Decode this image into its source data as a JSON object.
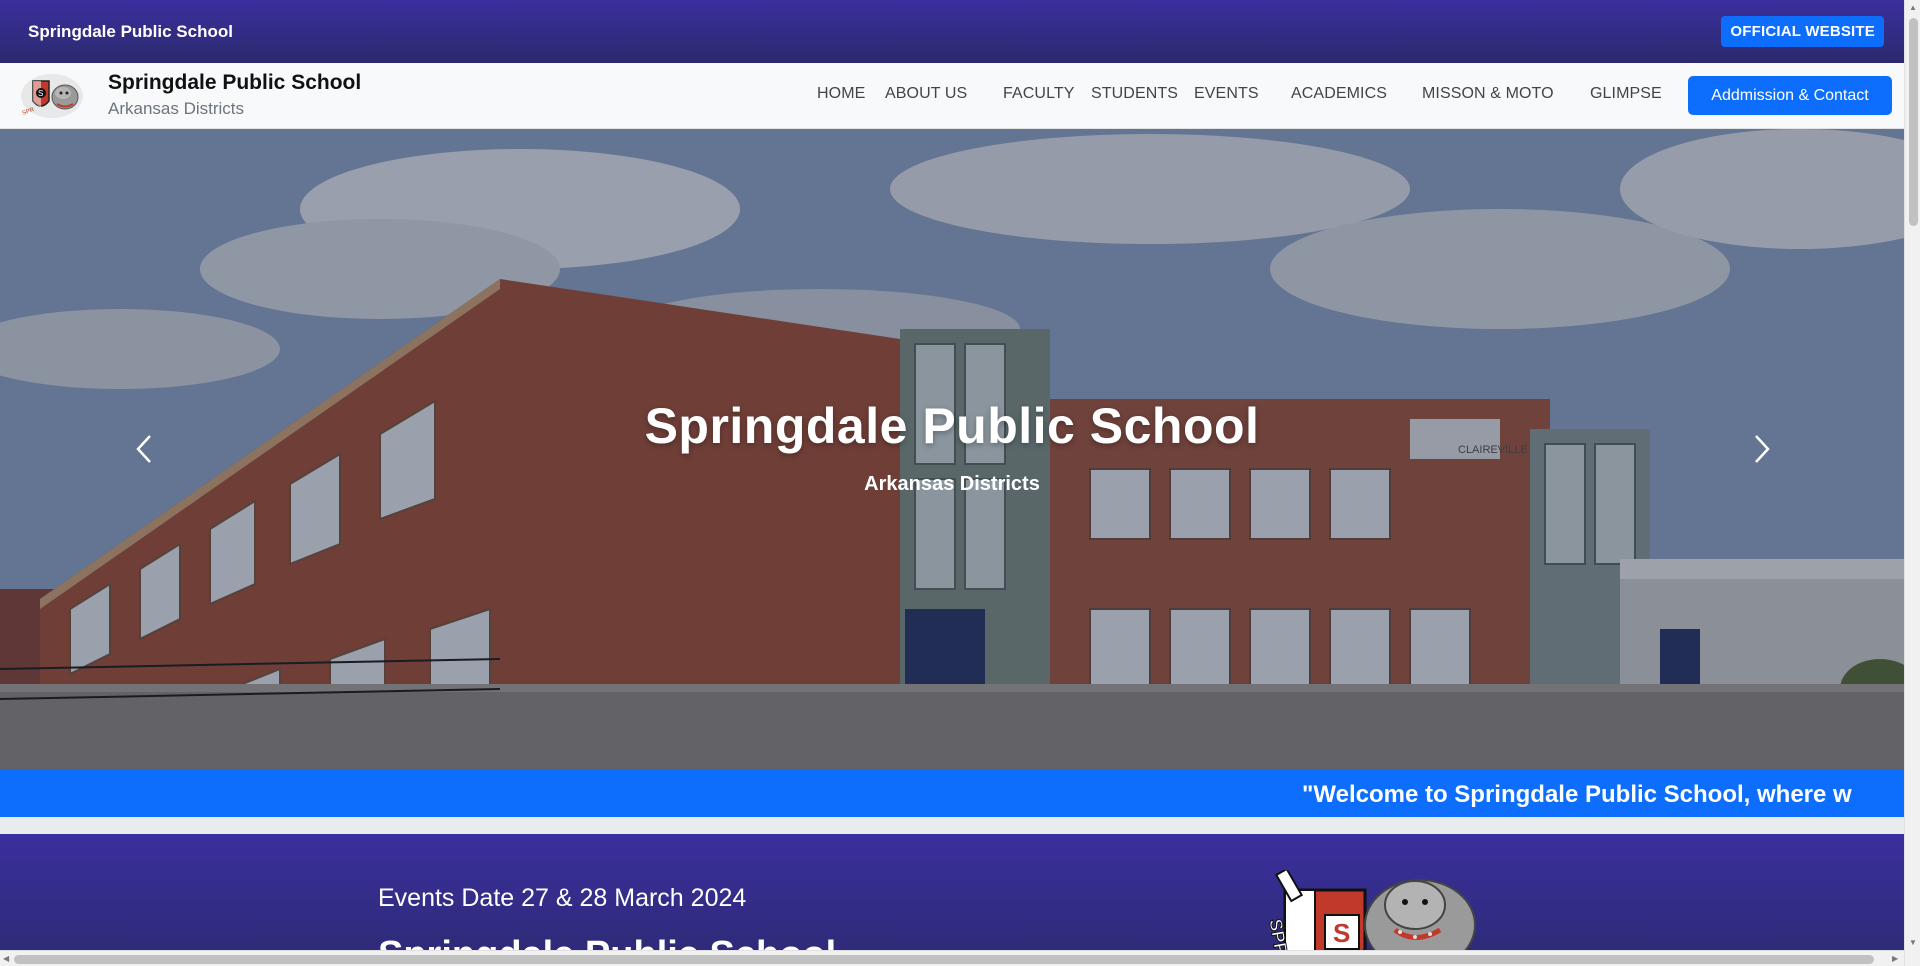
{
  "topbar": {
    "title": "Springdale Public School",
    "official_button": "OFFICIAL WEBSITE"
  },
  "navbar": {
    "brand_name": "Springdale Public School",
    "brand_sub": "Arkansas Districts",
    "links": [
      "HOME",
      "ABOUT US",
      "FACULTY",
      "STUDENTS",
      "EVENTS",
      "ACADEMICS",
      "MISSON & MOTO",
      "GLIMPSE"
    ],
    "contact_button": "Addmission & Contact"
  },
  "hero": {
    "title": "Springdale Public School",
    "subtitle": "Arkansas Districts",
    "building_sign": "CLAIREVILLE PUBLIC SCHOOL"
  },
  "ticker": {
    "text": "\"Welcome to Springdale Public School, where w"
  },
  "events": {
    "date": "Events Date 27 & 28 March 2024",
    "title": "Springdale Public School"
  },
  "colors": {
    "primary": "#0d6efd",
    "header_purple": "#3a2f9e",
    "header_dark": "#2b2a6e"
  },
  "icons": {
    "logo": "school-crest-logo",
    "prev": "chevron-left-icon",
    "next": "chevron-right-icon",
    "mascot": "bulldog-mascot"
  }
}
